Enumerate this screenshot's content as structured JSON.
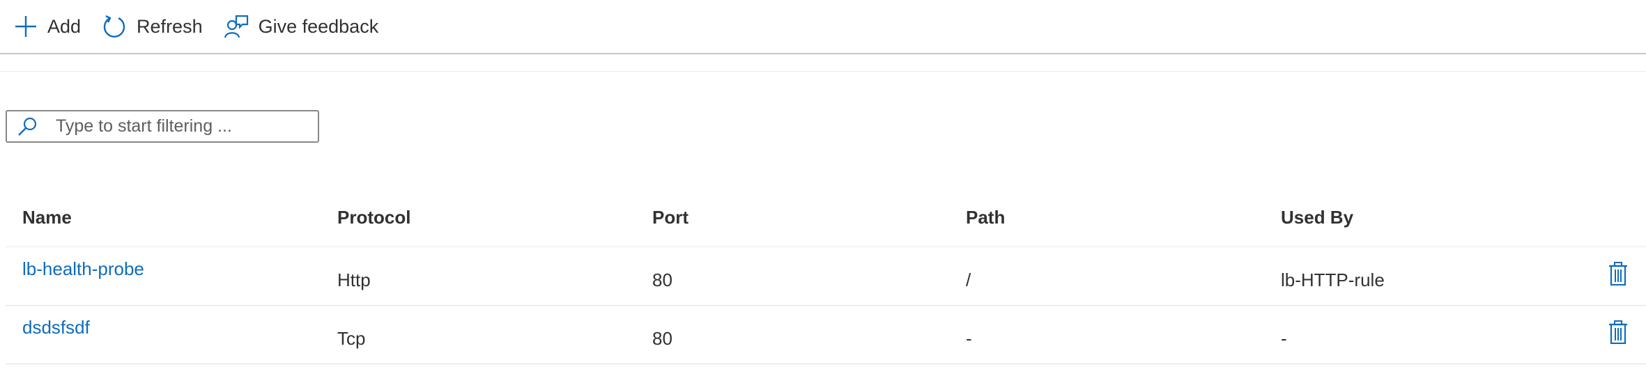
{
  "toolbar": {
    "add_label": "Add",
    "refresh_label": "Refresh",
    "feedback_label": "Give feedback"
  },
  "filter": {
    "placeholder": "Type to start filtering ..."
  },
  "table": {
    "columns": [
      "Name",
      "Protocol",
      "Port",
      "Path",
      "Used By"
    ],
    "rows": [
      {
        "name": "lb-health-probe",
        "protocol": "Http",
        "port": "80",
        "path": "/",
        "used_by": "lb-HTTP-rule"
      },
      {
        "name": "dsdsfsdf",
        "protocol": "Tcp",
        "port": "80",
        "path": "-",
        "used_by": "-"
      }
    ]
  },
  "colors": {
    "accent": "#0f6cbd",
    "text": "#323130",
    "border": "#8a8886"
  }
}
